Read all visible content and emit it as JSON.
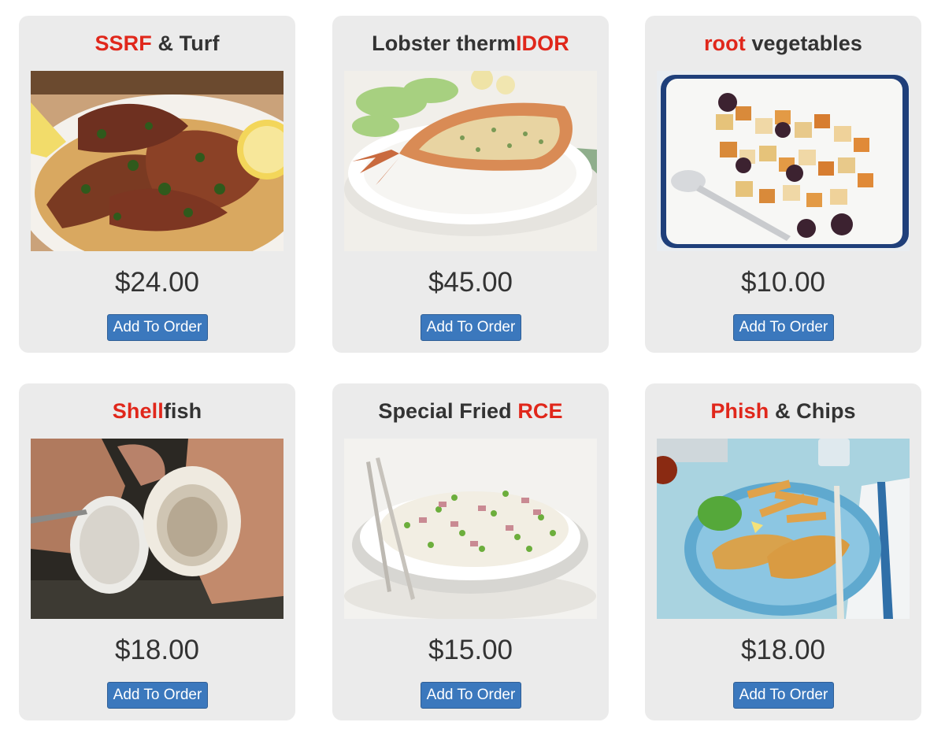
{
  "menu": {
    "button_label": "Add To Order",
    "items": [
      {
        "title_parts": [
          {
            "text": "SSRF",
            "highlight": true
          },
          {
            "text": " & Turf",
            "highlight": false
          }
        ],
        "price": "$24.00"
      },
      {
        "title_parts": [
          {
            "text": "Lobster therm",
            "highlight": false
          },
          {
            "text": "IDOR",
            "highlight": true
          }
        ],
        "price": "$45.00"
      },
      {
        "title_parts": [
          {
            "text": "root",
            "highlight": true
          },
          {
            "text": " vegetables",
            "highlight": false
          }
        ],
        "price": "$10.00"
      },
      {
        "title_parts": [
          {
            "text": "Shell",
            "highlight": true
          },
          {
            "text": "fish",
            "highlight": false
          }
        ],
        "price": "$18.00"
      },
      {
        "title_parts": [
          {
            "text": "Special Fried ",
            "highlight": false
          },
          {
            "text": "RCE",
            "highlight": true
          }
        ],
        "price": "$15.00"
      },
      {
        "title_parts": [
          {
            "text": "Phish",
            "highlight": true
          },
          {
            "text": " & Chips",
            "highlight": false
          }
        ],
        "price": "$18.00"
      }
    ]
  },
  "colors": {
    "highlight": "#e0271b",
    "text": "#333333",
    "card_background": "#ebebeb",
    "button": "#3b78bd"
  }
}
